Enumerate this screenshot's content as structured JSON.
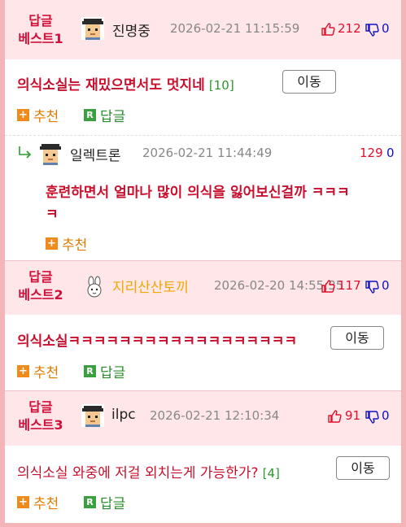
{
  "posts": [
    {
      "badge_line1": "답글",
      "badge_line2": "베스트1",
      "username": "진명중",
      "avatar_icon": "pixel-face-icon",
      "date": "2026-02-21 11:15:59",
      "up_count": "212",
      "down_count": "0",
      "title": "의식소실는 재밌으면서도 멋지네",
      "comment_count": "[10]",
      "move_label": "이동",
      "recommend_label": "추천",
      "reply_label": "답글",
      "reply": {
        "username": "일렉트론",
        "avatar_icon": "pixel-face-icon",
        "date": "2026-02-21 11:44:49",
        "up_count": "129",
        "down_count": "0",
        "text_line1": "훈련하면서 얼마나 많이 의식을 잃어보신걸까 ㅋㅋㅋ",
        "text_line2": "ㅋ",
        "recommend_label": "추천"
      }
    },
    {
      "badge_line1": "답글",
      "badge_line2": "베스트2",
      "username": "지리산산토끼",
      "avatar_icon": "rabbit-icon",
      "date": "2026-02-20 14:55:35",
      "up_count": "117",
      "down_count": "0",
      "title": "의식소실ㅋㅋㅋㅋㅋㅋㅋㅋㅋㅋㅋㅋㅋㅋㅋㅋㅋㅋ",
      "move_label": "이동",
      "recommend_label": "추천",
      "reply_label": "답글"
    },
    {
      "badge_line1": "답글",
      "badge_line2": "베스트3",
      "username": "ilpc",
      "avatar_icon": "pixel-face-icon",
      "date": "2026-02-21 12:10:34",
      "up_count": "91",
      "down_count": "0",
      "title": "의식소실 와중에 저걸 외치는게 가능한가?",
      "comment_count": "[4]",
      "move_label": "이동",
      "recommend_label": "추천",
      "reply_label": "답글"
    }
  ],
  "colors": {
    "band_bg": "#ffe6e8",
    "badge_red": "#d0103a",
    "title_red": "#c8102e",
    "up_red": "#e0102c",
    "down_blue": "#1010c0",
    "rabbit_name": "#f0a800",
    "recommend_orange": "#e07b00",
    "reply_green": "#2e8b2e"
  }
}
